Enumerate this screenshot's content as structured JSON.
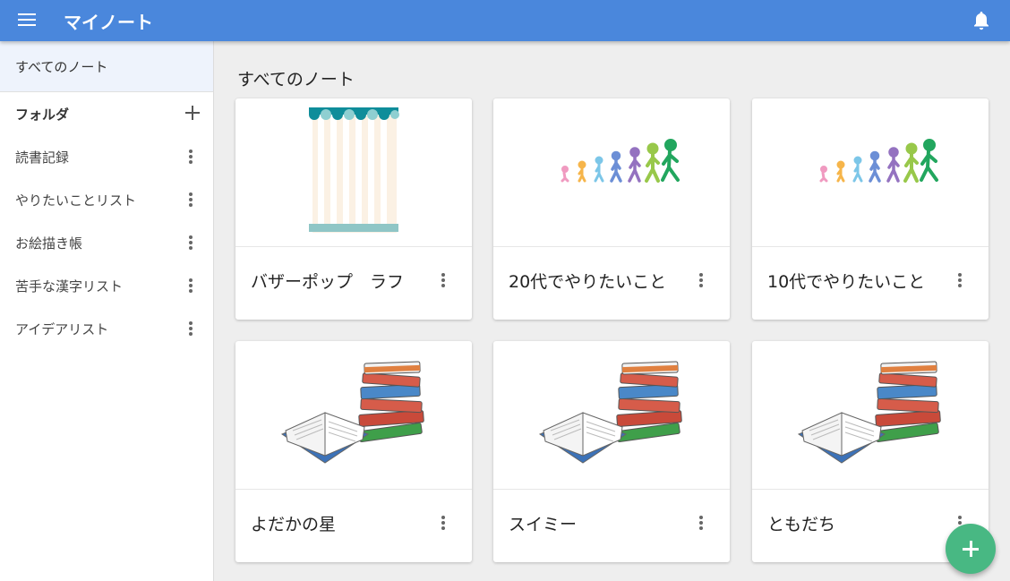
{
  "app": {
    "title": "マイノート"
  },
  "sidebar": {
    "all_notes": "すべてのノート",
    "folder_header": "フォルダ",
    "folders": [
      {
        "label": "読書記録"
      },
      {
        "label": "やりたいことリスト"
      },
      {
        "label": "お絵描き帳"
      },
      {
        "label": "苦手な漢字リスト"
      },
      {
        "label": "アイデアリスト"
      }
    ]
  },
  "main": {
    "title": "すべてのノート",
    "notes": [
      {
        "title": "バザーポップ　ラフ",
        "image": "striped-awning"
      },
      {
        "title": "20代でやりたいこと",
        "image": "growth-walkers"
      },
      {
        "title": "10代でやりたいこと",
        "image": "growth-walkers"
      },
      {
        "title": "よだかの星",
        "image": "book-stack"
      },
      {
        "title": "スイミー",
        "image": "book-stack"
      },
      {
        "title": "ともだち",
        "image": "book-stack"
      }
    ]
  },
  "icons": {
    "menu": "hamburger-menu-icon",
    "bell": "bell-icon",
    "add": "plus-icon",
    "more": "more-vert-icon",
    "fab": "add-fab-icon"
  },
  "colors": {
    "appbar": "#4a87dc",
    "fab": "#48b883",
    "sidebar_selected": "#eef3fc",
    "background": "#eeeeee"
  }
}
